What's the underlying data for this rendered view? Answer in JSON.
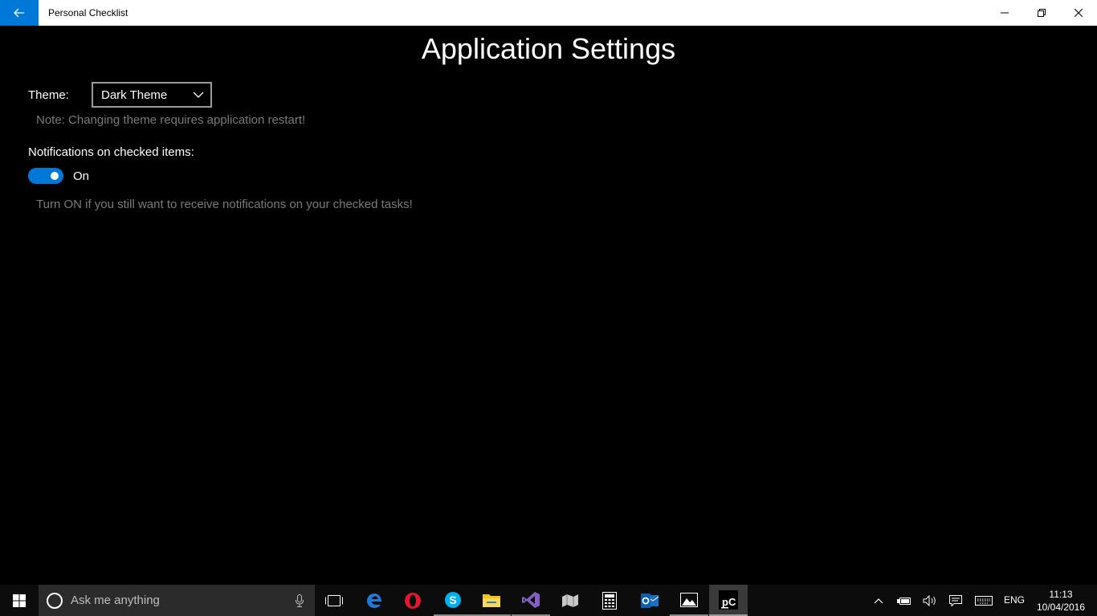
{
  "window": {
    "title": "Personal Checklist"
  },
  "page": {
    "title": "Application Settings"
  },
  "settings": {
    "theme_label": "Theme:",
    "theme_value": "Dark Theme",
    "theme_note": "Note: Changing theme requires application restart!",
    "notifications_label": "Notifications on checked items:",
    "notifications_state": "On",
    "notifications_on": true,
    "notifications_note": "Turn ON if you still want to receive notifications on your checked tasks!"
  },
  "taskbar": {
    "search_placeholder": "Ask me anything",
    "apps": [
      "task-view-icon",
      "edge-icon",
      "opera-icon",
      "skype-icon",
      "file-explorer-icon",
      "visual-studio-icon",
      "maps-icon",
      "calculator-icon",
      "outlook-icon",
      "photos-icon",
      "pycharm-icon"
    ],
    "language": "ENG",
    "time": "11:13",
    "date": "10/04/2016"
  },
  "colors": {
    "accent": "#0078d7",
    "background": "#000000",
    "muted_text": "#7a7a7a"
  }
}
